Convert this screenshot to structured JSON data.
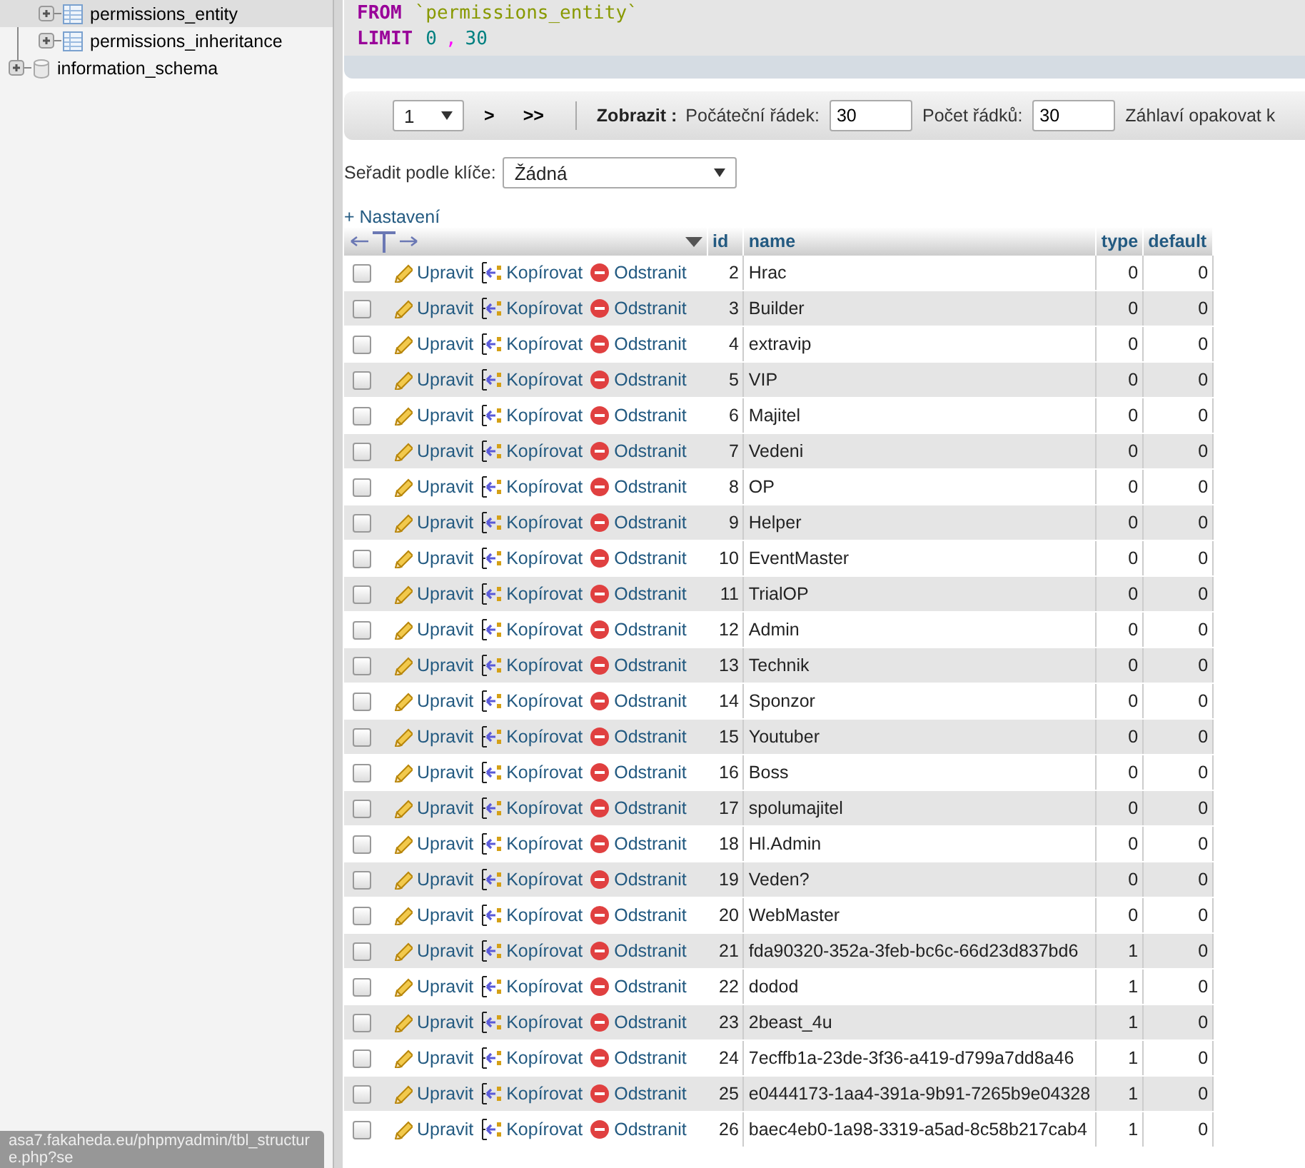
{
  "sidebar": {
    "tree": [
      {
        "label": "permissions_entity",
        "kind": "table",
        "selected": true,
        "expanded": false
      },
      {
        "label": "permissions_inheritance",
        "kind": "table",
        "selected": false,
        "expanded": false
      },
      {
        "label": "information_schema",
        "kind": "database",
        "selected": false,
        "expanded": false
      }
    ]
  },
  "sql": {
    "lines": [
      {
        "keyword": "FROM",
        "rest": [
          {
            "kind": "ident",
            "text": "`permissions_entity`"
          }
        ]
      },
      {
        "keyword": "LIMIT",
        "rest": [
          {
            "kind": "num",
            "text": "0"
          },
          {
            "kind": "punct",
            "text": ","
          },
          {
            "kind": "num",
            "text": "30"
          }
        ]
      }
    ]
  },
  "navigation": {
    "page": "1",
    "next": ">",
    "last": ">>",
    "show_label": "Zobrazit :",
    "start_label": "Počáteční řádek:",
    "start_value": "30",
    "count_label": "Počet řádků:",
    "count_value": "30",
    "repeat_label": "Záhlaví opakovat k"
  },
  "sort": {
    "label": "Seřadit podle klíče:",
    "value": "Žádná"
  },
  "options_link": "+ Nastavení",
  "table": {
    "columns": [
      "id",
      "name",
      "type",
      "default"
    ],
    "rows": [
      {
        "checked": false,
        "actions": {
          "edit": "Upravit",
          "copy": "Kopírovat",
          "delete": "Odstranit"
        },
        "cells": [
          "2",
          "Hrac",
          "0",
          "0"
        ]
      },
      {
        "checked": false,
        "actions": {
          "edit": "Upravit",
          "copy": "Kopírovat",
          "delete": "Odstranit"
        },
        "cells": [
          "3",
          "Builder",
          "0",
          "0"
        ]
      },
      {
        "checked": false,
        "actions": {
          "edit": "Upravit",
          "copy": "Kopírovat",
          "delete": "Odstranit"
        },
        "cells": [
          "4",
          "extravip",
          "0",
          "0"
        ]
      },
      {
        "checked": false,
        "actions": {
          "edit": "Upravit",
          "copy": "Kopírovat",
          "delete": "Odstranit"
        },
        "cells": [
          "5",
          "VIP",
          "0",
          "0"
        ]
      },
      {
        "checked": false,
        "actions": {
          "edit": "Upravit",
          "copy": "Kopírovat",
          "delete": "Odstranit"
        },
        "cells": [
          "6",
          "Majitel",
          "0",
          "0"
        ]
      },
      {
        "checked": false,
        "actions": {
          "edit": "Upravit",
          "copy": "Kopírovat",
          "delete": "Odstranit"
        },
        "cells": [
          "7",
          "Vedeni",
          "0",
          "0"
        ]
      },
      {
        "checked": false,
        "actions": {
          "edit": "Upravit",
          "copy": "Kopírovat",
          "delete": "Odstranit"
        },
        "cells": [
          "8",
          "OP",
          "0",
          "0"
        ]
      },
      {
        "checked": false,
        "actions": {
          "edit": "Upravit",
          "copy": "Kopírovat",
          "delete": "Odstranit"
        },
        "cells": [
          "9",
          "Helper",
          "0",
          "0"
        ]
      },
      {
        "checked": false,
        "actions": {
          "edit": "Upravit",
          "copy": "Kopírovat",
          "delete": "Odstranit"
        },
        "cells": [
          "10",
          "EventMaster",
          "0",
          "0"
        ]
      },
      {
        "checked": false,
        "actions": {
          "edit": "Upravit",
          "copy": "Kopírovat",
          "delete": "Odstranit"
        },
        "cells": [
          "11",
          "TrialOP",
          "0",
          "0"
        ]
      },
      {
        "checked": false,
        "actions": {
          "edit": "Upravit",
          "copy": "Kopírovat",
          "delete": "Odstranit"
        },
        "cells": [
          "12",
          "Admin",
          "0",
          "0"
        ]
      },
      {
        "checked": false,
        "actions": {
          "edit": "Upravit",
          "copy": "Kopírovat",
          "delete": "Odstranit"
        },
        "cells": [
          "13",
          "Technik",
          "0",
          "0"
        ]
      },
      {
        "checked": false,
        "actions": {
          "edit": "Upravit",
          "copy": "Kopírovat",
          "delete": "Odstranit"
        },
        "cells": [
          "14",
          "Sponzor",
          "0",
          "0"
        ]
      },
      {
        "checked": false,
        "actions": {
          "edit": "Upravit",
          "copy": "Kopírovat",
          "delete": "Odstranit"
        },
        "cells": [
          "15",
          "Youtuber",
          "0",
          "0"
        ]
      },
      {
        "checked": false,
        "actions": {
          "edit": "Upravit",
          "copy": "Kopírovat",
          "delete": "Odstranit"
        },
        "cells": [
          "16",
          "Boss",
          "0",
          "0"
        ]
      },
      {
        "checked": false,
        "actions": {
          "edit": "Upravit",
          "copy": "Kopírovat",
          "delete": "Odstranit"
        },
        "cells": [
          "17",
          "spolumajitel",
          "0",
          "0"
        ]
      },
      {
        "checked": false,
        "actions": {
          "edit": "Upravit",
          "copy": "Kopírovat",
          "delete": "Odstranit"
        },
        "cells": [
          "18",
          "Hl.Admin",
          "0",
          "0"
        ]
      },
      {
        "checked": false,
        "actions": {
          "edit": "Upravit",
          "copy": "Kopírovat",
          "delete": "Odstranit"
        },
        "cells": [
          "19",
          "Veden?",
          "0",
          "0"
        ]
      },
      {
        "checked": false,
        "actions": {
          "edit": "Upravit",
          "copy": "Kopírovat",
          "delete": "Odstranit"
        },
        "cells": [
          "20",
          "WebMaster",
          "0",
          "0"
        ]
      },
      {
        "checked": false,
        "actions": {
          "edit": "Upravit",
          "copy": "Kopírovat",
          "delete": "Odstranit"
        },
        "cells": [
          "21",
          "fda90320-352a-3feb-bc6c-66d23d837bd6",
          "1",
          "0"
        ]
      },
      {
        "checked": false,
        "actions": {
          "edit": "Upravit",
          "copy": "Kopírovat",
          "delete": "Odstranit"
        },
        "cells": [
          "22",
          "dodod",
          "1",
          "0"
        ]
      },
      {
        "checked": false,
        "actions": {
          "edit": "Upravit",
          "copy": "Kopírovat",
          "delete": "Odstranit"
        },
        "cells": [
          "23",
          "2beast_4u",
          "1",
          "0"
        ]
      },
      {
        "checked": false,
        "actions": {
          "edit": "Upravit",
          "copy": "Kopírovat",
          "delete": "Odstranit"
        },
        "cells": [
          "24",
          "7ecffb1a-23de-3f36-a419-d799a7dd8a46",
          "1",
          "0"
        ]
      },
      {
        "checked": false,
        "actions": {
          "edit": "Upravit",
          "copy": "Kopírovat",
          "delete": "Odstranit"
        },
        "cells": [
          "25",
          "e0444173-1aa4-391a-9b91-7265b9e04328",
          "1",
          "0"
        ]
      },
      {
        "checked": false,
        "actions": {
          "edit": "Upravit",
          "copy": "Kopírovat",
          "delete": "Odstranit"
        },
        "cells": [
          "26",
          "baec4eb0-1a98-3319-a5ad-8c58b217cab4",
          "1",
          "0"
        ]
      }
    ]
  },
  "status_bar": {
    "url": "asa7.fakaheda.eu/phpmyadmin/tbl_structure.php?se"
  }
}
